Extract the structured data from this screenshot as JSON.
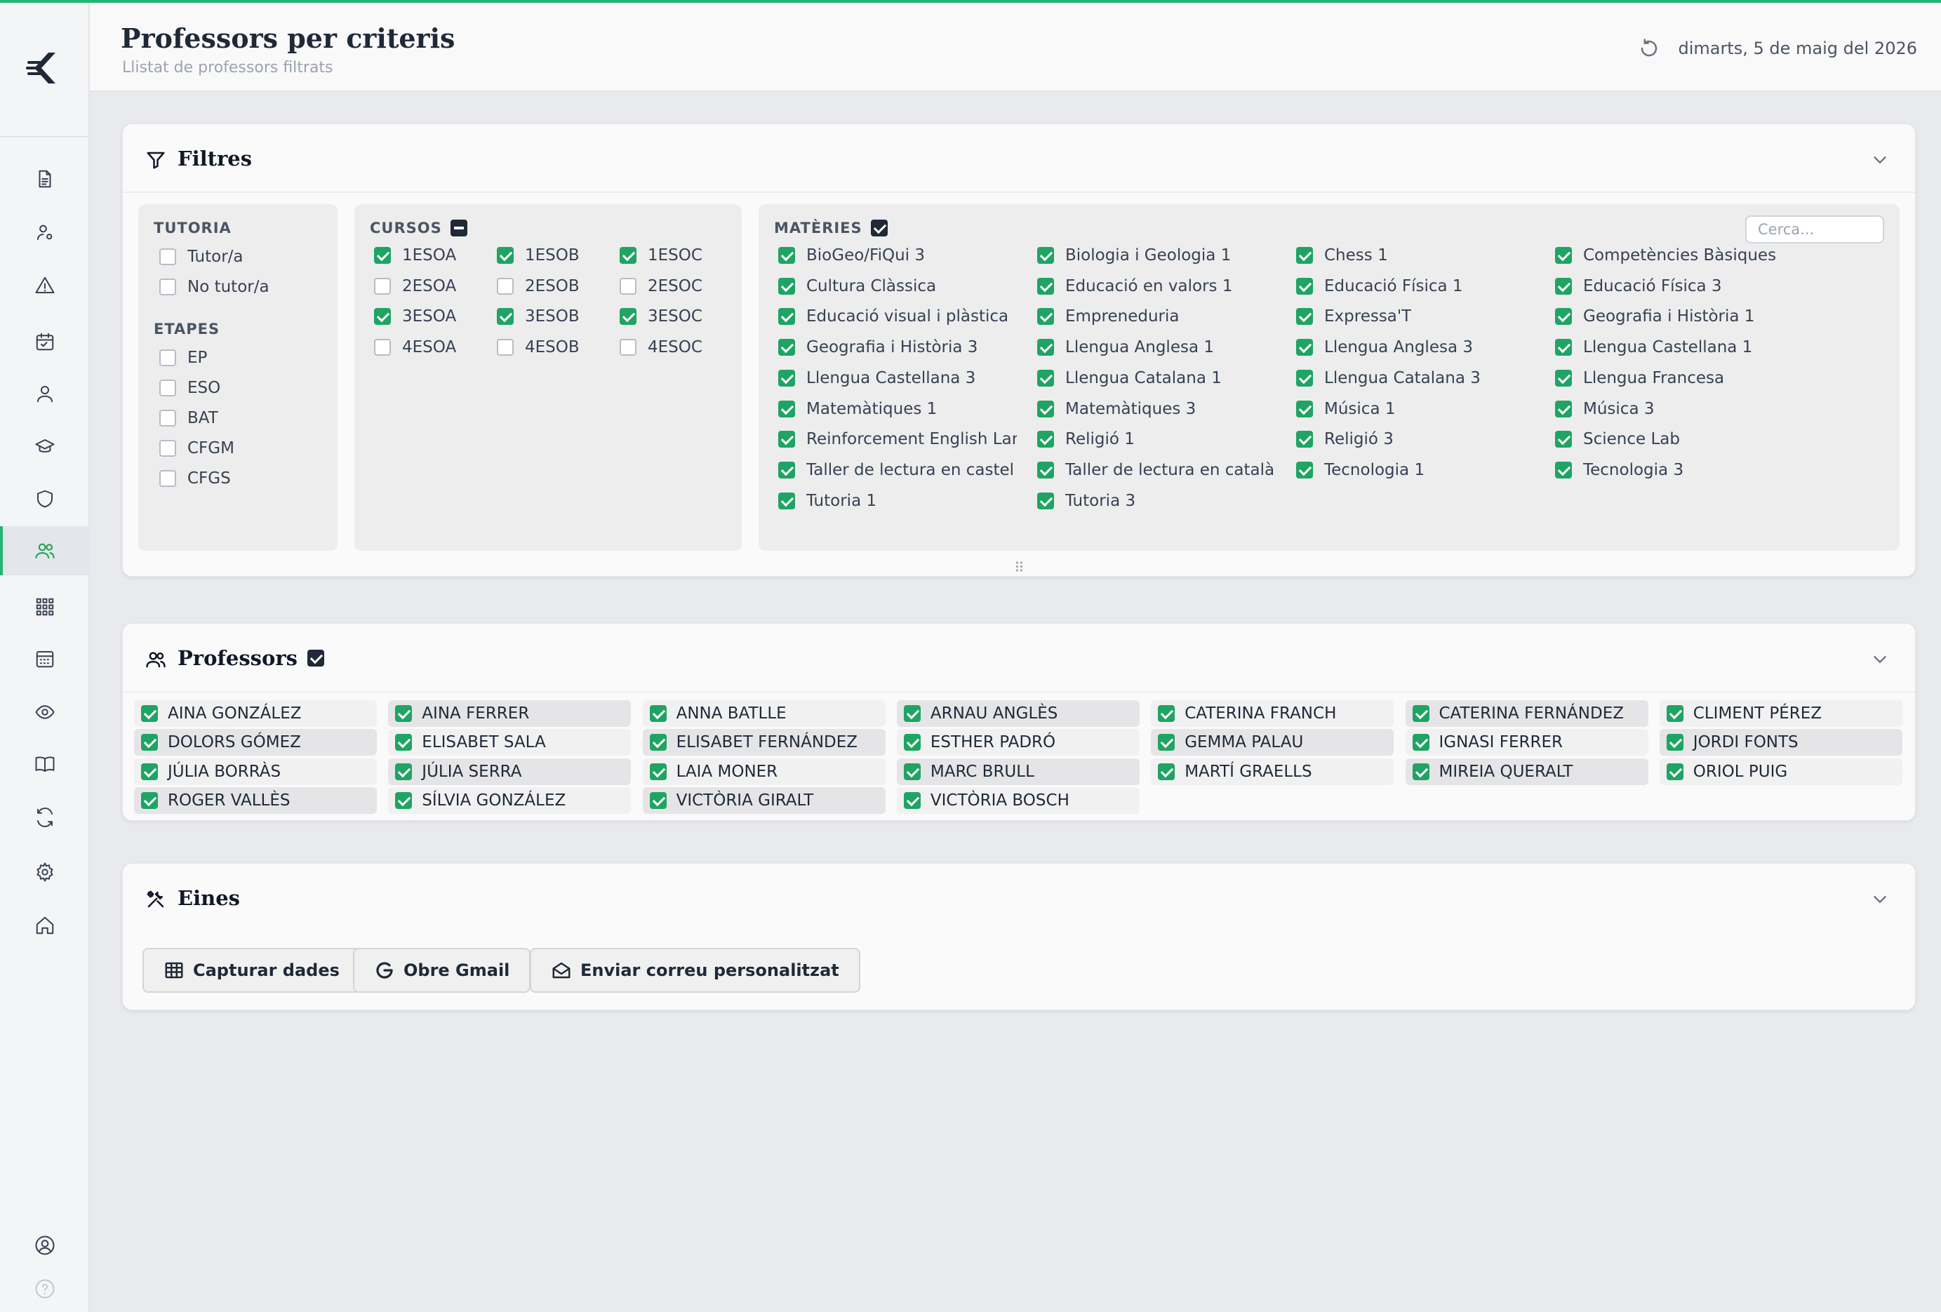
{
  "header": {
    "title": "Professors per criteris",
    "subtitle": "Llistat de professors filtrats",
    "date": "dimarts, 5 de maig del 2026"
  },
  "filters": {
    "title": "Filtres",
    "tutoria": {
      "label": "TUTORIA",
      "options": [
        {
          "label": "Tutor/a",
          "checked": false
        },
        {
          "label": "No tutor/a",
          "checked": false
        }
      ]
    },
    "etapes": {
      "label": "ETAPES",
      "options": [
        {
          "label": "EP",
          "checked": false
        },
        {
          "label": "ESO",
          "checked": false
        },
        {
          "label": "BAT",
          "checked": false
        },
        {
          "label": "CFGM",
          "checked": false
        },
        {
          "label": "CFGS",
          "checked": false
        }
      ]
    },
    "cursos": {
      "label": "CURSOS",
      "rows": [
        [
          {
            "label": "1ESOA",
            "checked": true
          },
          {
            "label": "1ESOB",
            "checked": true
          },
          {
            "label": "1ESOC",
            "checked": true
          }
        ],
        [
          {
            "label": "2ESOA",
            "checked": false
          },
          {
            "label": "2ESOB",
            "checked": false
          },
          {
            "label": "2ESOC",
            "checked": false
          }
        ],
        [
          {
            "label": "3ESOA",
            "checked": true
          },
          {
            "label": "3ESOB",
            "checked": true
          },
          {
            "label": "3ESOC",
            "checked": true
          }
        ],
        [
          {
            "label": "4ESOA",
            "checked": false
          },
          {
            "label": "4ESOB",
            "checked": false
          },
          {
            "label": "4ESOC",
            "checked": false
          }
        ]
      ]
    },
    "materies": {
      "label": "MATÈRIES",
      "search_placeholder": "Cerca...",
      "rows": [
        [
          "BioGeo/FiQui 3",
          "Biologia i Geologia 1",
          "Chess 1",
          "Competències Bàsiques"
        ],
        [
          "Cultura Clàssica",
          "Educació en valors 1",
          "Educació Física 1",
          "Educació Física 3"
        ],
        [
          "Educació visual i plàstica",
          "Empreneduria",
          "Expressa'T",
          "Geografia i Història 1"
        ],
        [
          "Geografia i Història 3",
          "Llengua Anglesa 1",
          "Llengua Anglesa 3",
          "Llengua Castellana 1"
        ],
        [
          "Llengua Castellana 3",
          "Llengua Catalana 1",
          "Llengua Catalana 3",
          "Llengua Francesa"
        ],
        [
          "Matemàtiques 1",
          "Matemàtiques 3",
          "Música 1",
          "Música 3"
        ],
        [
          "Reinforcement English Langu",
          "Religió 1",
          "Religió 3",
          "Science Lab"
        ],
        [
          "Taller de lectura en castel",
          "Taller de lectura en català",
          "Tecnologia 1",
          "Tecnologia 3"
        ],
        [
          "Tutoria 1",
          "Tutoria 3"
        ]
      ]
    }
  },
  "professors": {
    "title": "Professors",
    "rows": [
      [
        "AINA GONZÁLEZ",
        "AINA FERRER",
        "ANNA BATLLE",
        "ARNAU ANGLÈS",
        "CATERINA FRANCH",
        "CATERINA FERNÁNDEZ",
        "CLIMENT PÉREZ"
      ],
      [
        "DOLORS GÓMEZ",
        "ELISABET SALA",
        "ELISABET FERNÁNDEZ",
        "ESTHER PADRÓ",
        "GEMMA PALAU",
        "IGNASI FERRER",
        "JORDI FONTS"
      ],
      [
        "JÚLIA BORRÀS",
        "JÚLIA SERRA",
        "LAIA MONER",
        "MARC BRULL",
        "MARTÍ GRAELLS",
        "MIREIA QUERALT",
        "ORIOL PUIG"
      ],
      [
        "ROGER VALLÈS",
        "SÍLVIA GONZÁLEZ",
        "VICTÒRIA GIRALT",
        "VICTÒRIA BOSCH"
      ]
    ]
  },
  "tools": {
    "title": "Eines",
    "buttons": [
      "Capturar dades",
      "Obre Gmail",
      "Enviar correu personalitzat"
    ]
  },
  "colors": {
    "accent": "#22b573",
    "checkbox_on": "#1fa463",
    "dark_checkbox": "#1f2937"
  }
}
